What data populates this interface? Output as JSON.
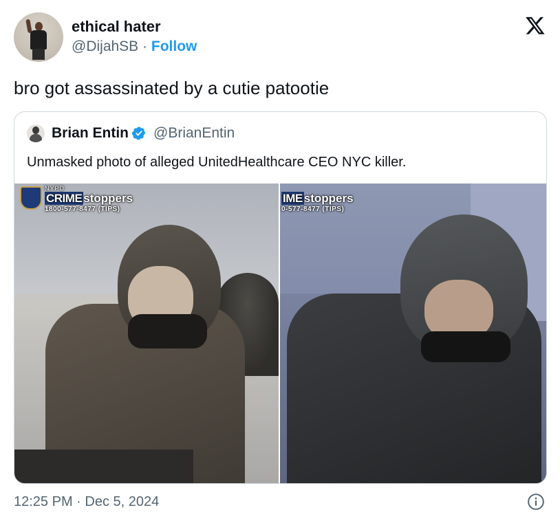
{
  "author": {
    "display_name": "ethical hater",
    "handle": "@DijahSB",
    "separator": "·",
    "follow_label": "Follow"
  },
  "tweet": {
    "text": "bro got assassinated by a cutie patootie",
    "timestamp": "12:25 PM · Dec 5, 2024"
  },
  "quoted": {
    "display_name": "Brian Entin",
    "handle": "@BrianEntin",
    "verified": true,
    "text": "Unmasked photo of alleged UnitedHealthcare CEO NYC killer.",
    "photos": [
      {
        "watermark_org": "NYPD",
        "watermark_title_a": "CRIME",
        "watermark_title_b": "stoppers",
        "watermark_phone": "1800-577-8477 (TIPS)"
      },
      {
        "watermark_title_a": "IME",
        "watermark_title_b": "stoppers",
        "watermark_phone": "0-577-8477 (TIPS)"
      }
    ]
  },
  "icons": {
    "brand": "x-logo-icon",
    "verified": "verified-badge-icon",
    "info": "info-icon"
  },
  "colors": {
    "link": "#1d9bf0",
    "secondary_text": "#536471",
    "border": "#cfd9de"
  }
}
